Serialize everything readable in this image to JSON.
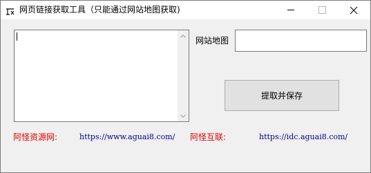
{
  "window": {
    "title": "网页链接获取工具（只能通过网站地图获取)",
    "icon": "app-logo-icon"
  },
  "controls": {
    "minimize_icon": "minimize-icon",
    "maximize_icon": "maximize-icon",
    "close_icon": "close-icon",
    "close_glyph": "✕"
  },
  "main": {
    "textarea_value": "",
    "sitemap_label": "网站地图",
    "sitemap_value": "",
    "save_button_label": "提取并保存"
  },
  "footer": {
    "resource_label": "阿怪资源网:",
    "resource_url": "https://www.aguai8.com/",
    "link_label": "阿怪互联:",
    "link_url": "https://idc.aguai8.com/"
  },
  "colors": {
    "accent_red": "#e00000",
    "link_blue": "#00008b",
    "window_bg": "#f0f0f0"
  }
}
